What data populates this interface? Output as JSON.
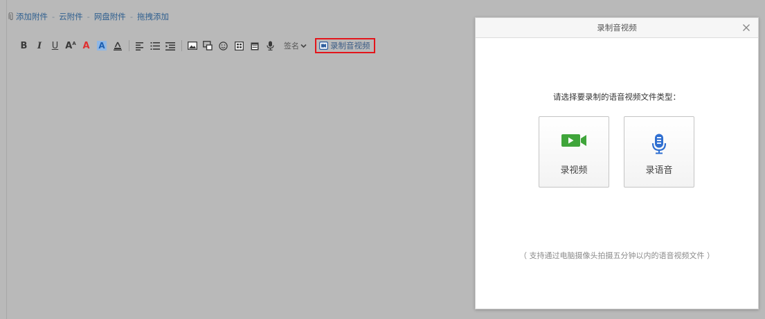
{
  "attachments": {
    "add_attachment": "添加附件",
    "separator": "-",
    "cloud_attachment": "云附件",
    "netdisk_attachment": "网盘附件",
    "drag_add": "拖拽添加"
  },
  "toolbar": {
    "bold": "B",
    "italic": "I",
    "underline": "U",
    "font_size": "A",
    "font_size_sup": "A",
    "font_color": "A",
    "bg_color": "A",
    "signature_label": "签名",
    "record_label": "录制音视频"
  },
  "dialog": {
    "title": "录制音视频",
    "prompt": "请选择要录制的语音视频文件类型：",
    "video_label": "录视频",
    "audio_label": "录语音",
    "note": "（ 支持通过电脑摄像头拍摄五分钟以内的语音视频文件 ）"
  },
  "colors": {
    "background": "#b9b9b9",
    "link": "#2f5f8f",
    "highlight_border": "#e3141a",
    "video_icon": "#3fa53a",
    "mic_icon": "#2f6fd1"
  },
  "icons": [
    "paperclip-icon",
    "strikethrough-icon",
    "align-left-icon",
    "bullet-list-icon",
    "indent-icon",
    "image-icon",
    "screenshot-icon",
    "emoji-icon",
    "table-icon",
    "calendar-icon",
    "microphone-icon",
    "chevron-down-icon",
    "video-record-icon",
    "close-icon",
    "video-camera-icon"
  ]
}
